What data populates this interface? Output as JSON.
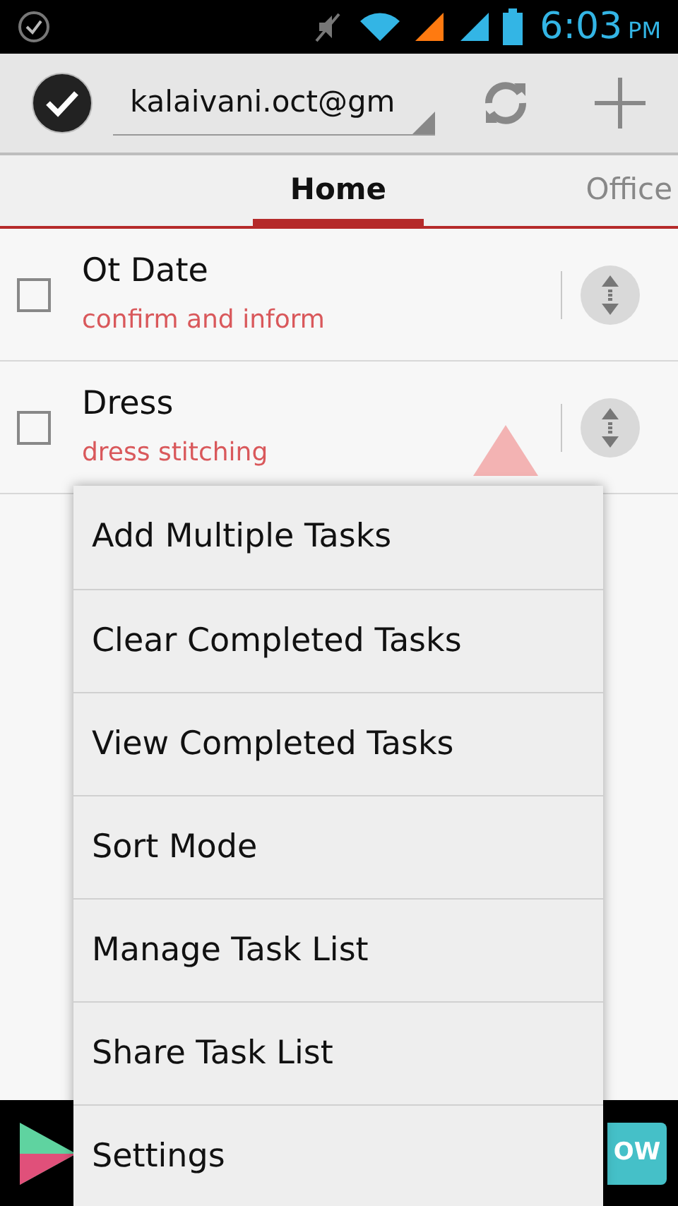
{
  "status_bar": {
    "time": "6:03",
    "ampm": "PM"
  },
  "action_bar": {
    "account": "kalaivani.oct@gm"
  },
  "tabs": [
    {
      "label": "Home",
      "selected": true
    },
    {
      "label": "Office",
      "selected": false
    }
  ],
  "tasks": [
    {
      "title": "Ot Date",
      "note": "confirm and inform",
      "checked": false,
      "warning": false
    },
    {
      "title": "Dress",
      "note": "dress stitching",
      "checked": false,
      "warning": true
    }
  ],
  "menu": [
    {
      "label": "Add Multiple Tasks"
    },
    {
      "label": "Clear Completed Tasks"
    },
    {
      "label": "View Completed Tasks"
    },
    {
      "label": "Sort Mode"
    },
    {
      "label": "Manage Task List"
    },
    {
      "label": "Share Task List"
    },
    {
      "label": "Settings"
    }
  ],
  "ad": {
    "button": "OW"
  }
}
